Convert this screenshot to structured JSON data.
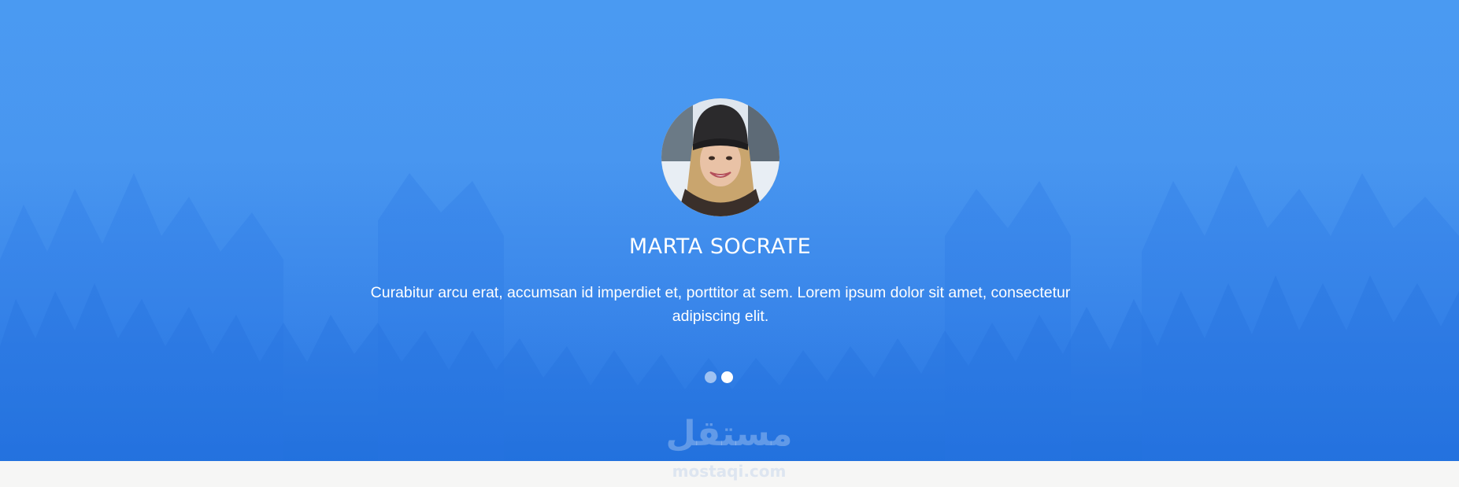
{
  "testimonial": {
    "name": "MARTA SOCRATE",
    "quote": "Curabitur arcu erat, accumsan id imperdiet et, porttitor at sem. Lorem ipsum dolor sit amet, consectetur adipiscing elit."
  },
  "carousel": {
    "slides": 2,
    "active_index": 1
  },
  "watermark": {
    "arabic": "مستقل",
    "latin": "mostaqi.com"
  },
  "colors": {
    "hero_top": "#4a9af2",
    "hero_bottom": "#2474e0",
    "text": "#ffffff",
    "footer": "#f6f6f5"
  }
}
